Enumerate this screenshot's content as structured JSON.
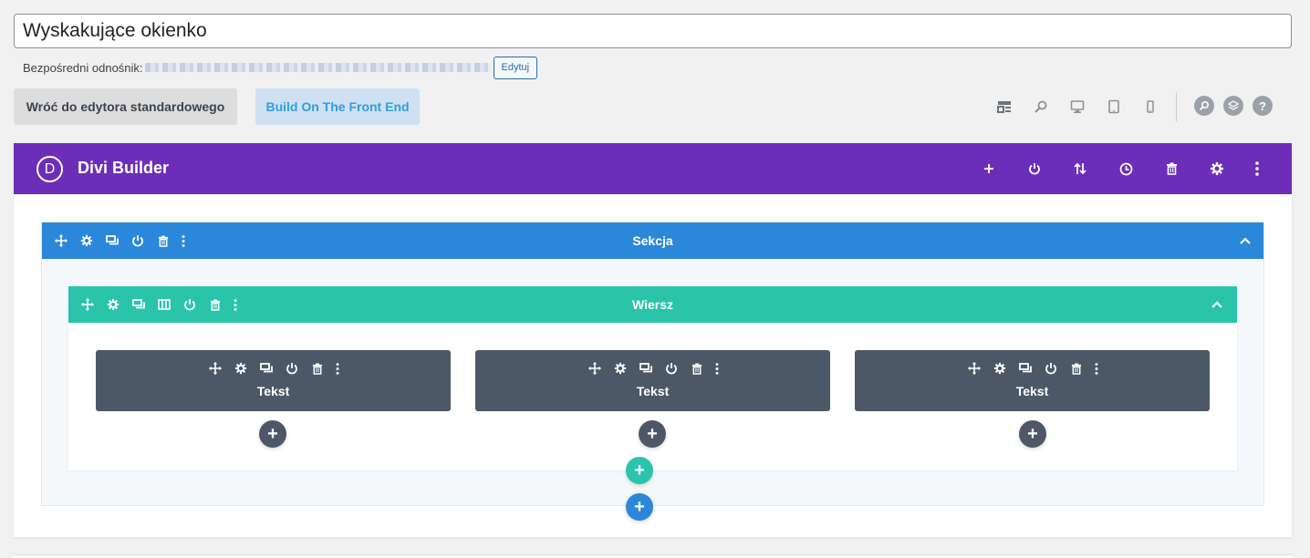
{
  "post": {
    "title": "Wyskakujące okienko",
    "permalink_label": "Bezpośredni odnośnik:",
    "edit_label": "Edytuj"
  },
  "toolbar": {
    "back_label": "Wróć do edytora standardowego",
    "front_label": "Build On The Front End",
    "view_icons": [
      "wireframe-icon",
      "zoom-icon",
      "desktop-icon",
      "tablet-icon",
      "phone-icon"
    ],
    "right_icons": [
      "search-icon",
      "layers-icon",
      "help-icon"
    ]
  },
  "builder": {
    "logo": "D",
    "title": "Divi Builder",
    "header_icons": [
      "plus-icon",
      "power-icon",
      "sort-icon",
      "history-icon",
      "trash-icon",
      "gear-icon",
      "more-icon"
    ],
    "colors": {
      "header": "#6c2eb9",
      "section": "#2b87da",
      "row": "#29c4a9",
      "module": "#4c5866"
    }
  },
  "section": {
    "title": "Sekcja"
  },
  "row": {
    "title": "Wiersz"
  },
  "modules": [
    {
      "title": "Tekst"
    },
    {
      "title": "Tekst"
    },
    {
      "title": "Tekst"
    }
  ],
  "add_symbol": "+"
}
